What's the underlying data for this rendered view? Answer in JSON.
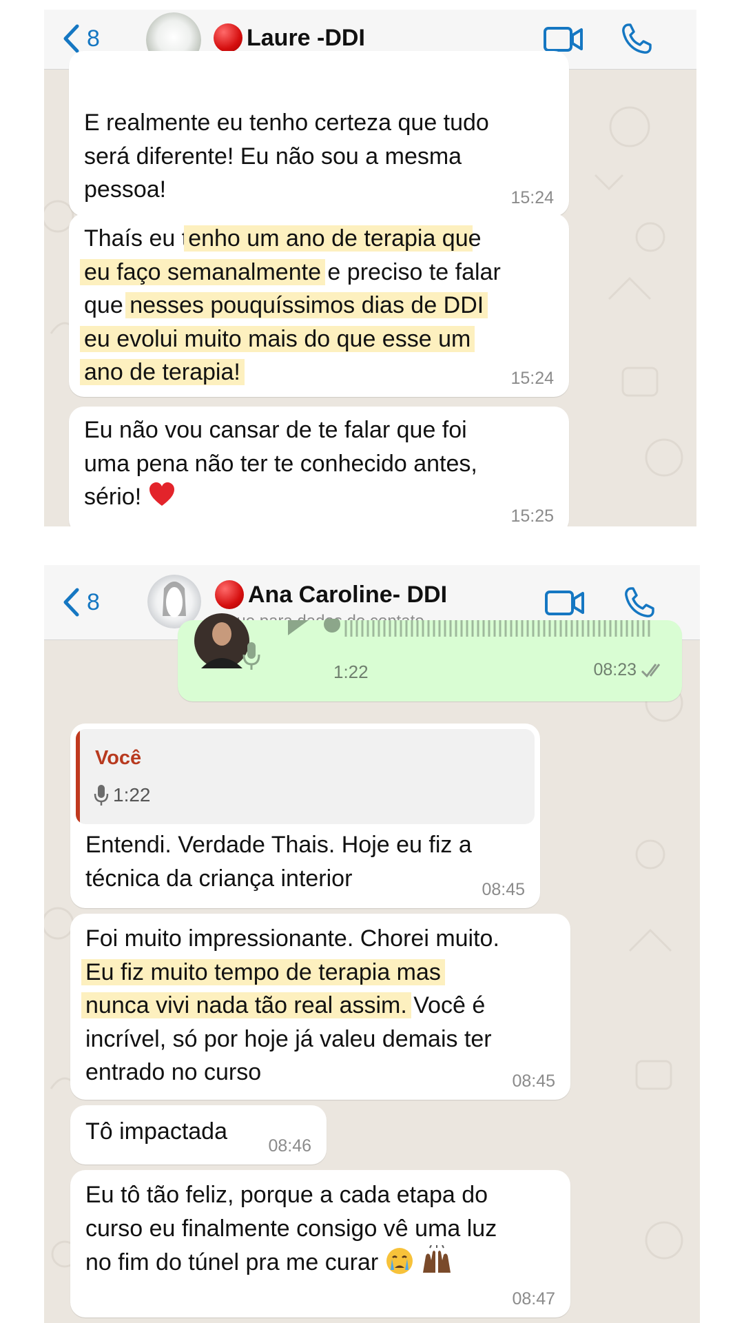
{
  "chat1": {
    "header": {
      "back_count": "8",
      "contact_name": "Laure -DDI"
    },
    "messages": [
      {
        "lines": [
          "E realmente eu tenho certeza que tudo",
          "será diferente! Eu não sou a mesma",
          "pessoa!"
        ],
        "time": "15:24"
      },
      {
        "line1_plain": "Thaís eu t",
        "line1_hl": "enho um ano de terapia qu",
        "line1_tail": "e",
        "line2_hl": "eu faço semanalmente",
        "line2_tail": " e preciso te falar",
        "line3_plain": "que ",
        "line3_hl": "nesses pouquíssimos dias de DDI",
        "line4_hl": "eu evolui muito mais do que esse um",
        "line5_hl": "ano de terapia!",
        "time": "15:24"
      },
      {
        "lines": [
          "Eu não vou cansar de te falar que foi",
          "uma pena não ter te conhecido antes,",
          "sério!"
        ],
        "emoji": "red-heart",
        "time": "15:25"
      }
    ]
  },
  "chat2": {
    "header": {
      "back_count": "8",
      "contact_name": "Ana Caroline- DDI",
      "subtitle": "toque para dados do contato"
    },
    "voice_message": {
      "duration": "1:22",
      "time": "08:23"
    },
    "messages": [
      {
        "quote_author": "Você",
        "quote_duration": "1:22",
        "lines": [
          "Entendi. Verdade Thais. Hoje eu fiz a",
          "técnica da criança interior"
        ],
        "time": "08:45"
      },
      {
        "line1": "Foi muito impressionante. Chorei muito.",
        "line2_hl": "Eu fiz muito tempo de terapia mas",
        "line3_hl": "nunca vivi nada tão real assim.",
        "line3_tail": " Você é",
        "line4": "incrível, só por hoje já valeu demais ter",
        "line5": "entrado no curso",
        "time": "08:45"
      },
      {
        "lines": [
          "Tô impactada"
        ],
        "time": "08:46"
      },
      {
        "lines": [
          "Eu tô tão feliz, porque a cada etapa do",
          "curso eu finalmente consigo vê uma luz",
          "no fim do túnel pra me curar"
        ],
        "emojis": [
          "crying-face",
          "raising-hands"
        ],
        "time": "08:47"
      }
    ]
  }
}
